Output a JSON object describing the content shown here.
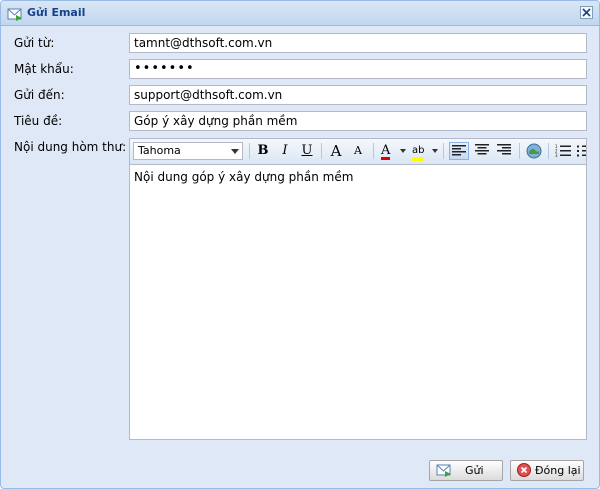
{
  "window": {
    "title": "Gửi Email"
  },
  "form": {
    "from_label": "Gửi từ:",
    "from_value": "tamnt@dthsoft.com.vn",
    "password_label": "Mật khẩu:",
    "password_value": "•••••••",
    "to_label": "Gửi đến:",
    "to_value": "support@dthsoft.com.vn",
    "subject_label": "Tiêu đề:",
    "subject_value": "Góp ý xây dựng phần mềm",
    "body_label": "Nội dung hòm thư:",
    "body_value": "Nội dung góp ý xây dựng phần mềm"
  },
  "toolbar": {
    "font_family": "Tahoma",
    "bold": "B",
    "italic": "I",
    "underline": "U",
    "grow_font": "A",
    "shrink_font": "A",
    "font_color": "A",
    "highlight": "ab",
    "align_left_active": true,
    "icons": [
      "bold-icon",
      "italic-icon",
      "underline-icon",
      "increase-font-icon",
      "decrease-font-icon",
      "font-color-icon",
      "highlight-icon",
      "align-left-icon",
      "align-center-icon",
      "align-right-icon",
      "insert-link-icon",
      "ordered-list-icon",
      "unordered-list-icon"
    ]
  },
  "buttons": {
    "send": "Gửi",
    "close": "Đóng lại"
  },
  "colors": {
    "titlebar_text": "#15428b",
    "window_bg": "#dfe8f6",
    "border": "#99bbe8",
    "font_color_bar": "#e00000",
    "highlight_bar": "#ffff00"
  }
}
